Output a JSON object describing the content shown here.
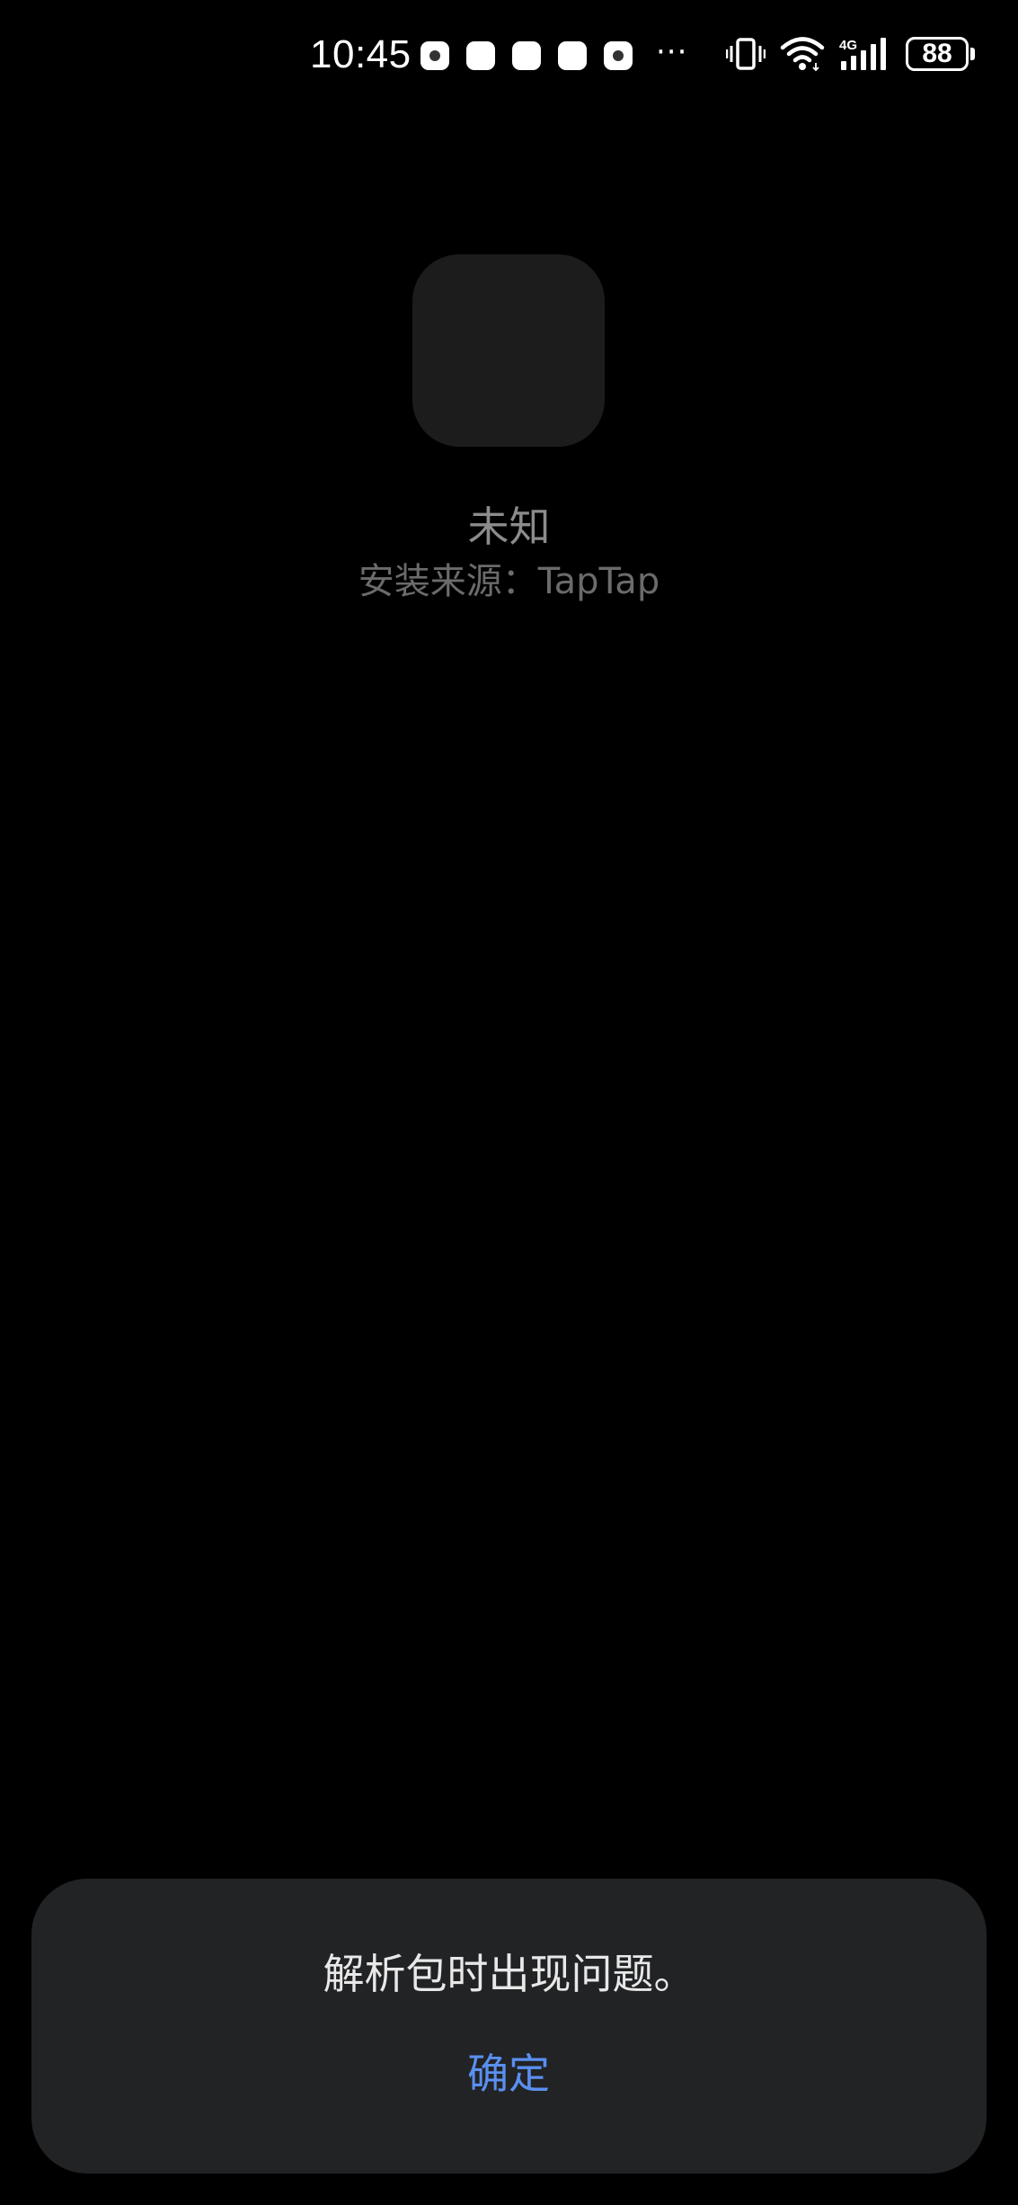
{
  "status_bar": {
    "time": "10:45",
    "more_indicator": "···",
    "battery_level": "88",
    "network_type": "4G",
    "notification_icons": [
      "app-notification-icon",
      "app-notification-icon",
      "app-notification-icon",
      "app-notification-icon",
      "app-notification-icon"
    ],
    "system_icons": [
      "vibrate-icon",
      "wifi-icon",
      "signal-4g-icon",
      "battery-icon"
    ]
  },
  "app": {
    "name": "未知",
    "source": "安装来源：TapTap"
  },
  "dialog": {
    "message": "解析包时出现问题。",
    "confirm_label": "确定"
  },
  "colors": {
    "background": "#000000",
    "dialog_background": "#222325",
    "accent": "#5a8ff0",
    "app_icon_placeholder": "#1c1c1c"
  }
}
